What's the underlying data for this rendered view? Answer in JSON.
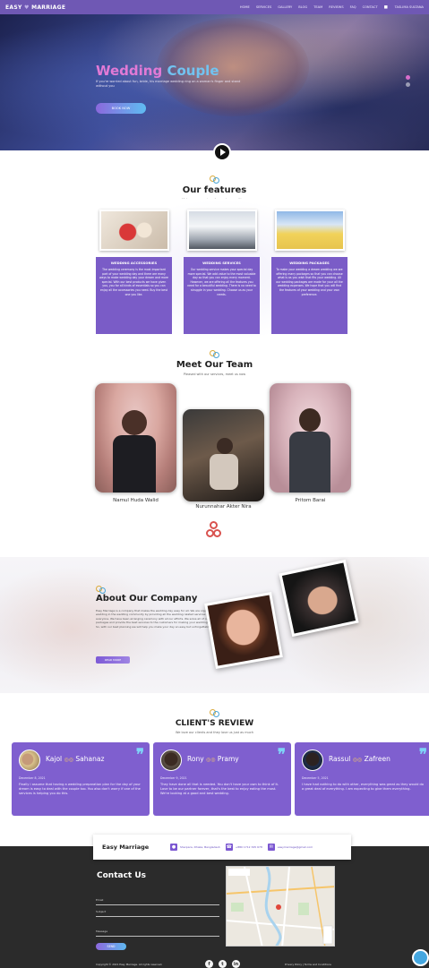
{
  "nav": {
    "logo": "EASY",
    "logo_accent": "MARRIAGE",
    "links": [
      "HOME",
      "SERVICES",
      "GALLERY",
      "BLOG",
      "TEAM",
      "REVIEWS",
      "FAQ",
      "CONTACT"
    ],
    "user_label": "TASLIMA SULTANA"
  },
  "hero": {
    "title_part1": "Wedding",
    "title_part2": "Couple",
    "subtitle": "If you're worried about fun, bride, his marriage wedding ring on a woman's finger and stand without you",
    "button": "BOOK NOW",
    "slides": 2,
    "active_slide": 1
  },
  "features": {
    "title": "Our features",
    "subtitle": "Make your marriage fun and easy with us",
    "cards": [
      {
        "title": "WEDDING ACCESSORIES",
        "text": "The wedding ceremony is the most important part of your wedding day and there are many ways to make wedding day your dream and more special. With our best products we have given you, you for all kinds of essentials so you can enjoy all the accessories you need. Buy the best one you like."
      },
      {
        "title": "WEDDING SERVICES",
        "text": "Our wedding service makes your special day more special. We add value to the most valuable day so that you can enjoy every moment. However, we are offering all the features you need for a beautiful wedding. There is no need to struggle in your wedding. Choose us as your needs."
      },
      {
        "title": "WEDDING PACKAGES",
        "text": "To make your wedding a dream wedding we are offering many packages so that you can choose what is as you wish that fits your wedding. All our wedding packages are made for your all the wedding expenses. We hope that you will find the features of your wedding and your own preference."
      }
    ]
  },
  "team": {
    "title": "Meet Our Team",
    "subtitle": "Pleased with our services, meet us now",
    "members": [
      "Namul Huda Walid",
      "Nurunnahar Akter Nira",
      "Pritom Barai"
    ]
  },
  "about": {
    "title": "About Our Company",
    "text": "Easy Marriage is a company that makes the wedding day easy for all. We are organizing a wedding in the wedding community by providing all the wedding related services to everyone. We have been arranging ceremony with all our efforts. We solve all of our packages and provide the best services to the customers for making your wedding special. So, with our best planning we will help you make your day an easy but unforgettable day.",
    "button": "READ MORE"
  },
  "reviews": {
    "title": "CLIENT'S REVIEW",
    "subtitle": "We love our clients and they love us just as much",
    "items": [
      {
        "name1": "Kajol",
        "name2": "Sahanaz",
        "date": "December 8, 2021",
        "text": "Finally i assume that having a wedding preparation plan for the day of your dream is easy to deal with the couple too. You also don't worry if one of the services is helping you do this."
      },
      {
        "name1": "Rony",
        "name2": "Pramy",
        "date": "December 9, 2021",
        "text": "They have done all that is needed. You don't have your own to think of it. Love to be our partner forever, that's the best to enjoy eating the most. We're looking at a good and best wedding."
      },
      {
        "name1": "Rassul",
        "name2": "Zafreen",
        "date": "December 5, 2021",
        "text": "I have had nothing to do with other, everything was great as they would do a great deal of everything. I am expecting to give them everything."
      }
    ]
  },
  "contact": {
    "brand": "Easy Marriage",
    "address": "Sherpara, Dhaka, Bangladesh",
    "phone": "+880 1712 345 678",
    "email": "easymarriage@gmail.com",
    "title": "Contact Us",
    "fields": [
      "Email",
      "Subject",
      "Message"
    ],
    "button": "SEND"
  },
  "footer": {
    "copyright": "Copyright © 2021 Easy Marriage. All rights reserved.",
    "right_text": "Privacy Policy | Terms and Conditions",
    "socials": [
      "f",
      "t",
      "in"
    ]
  },
  "colors": {
    "brand": "#6f58b4",
    "card": "#7a5cc7",
    "accent_pink": "#e27ad6",
    "accent_blue": "#71c3f1"
  }
}
